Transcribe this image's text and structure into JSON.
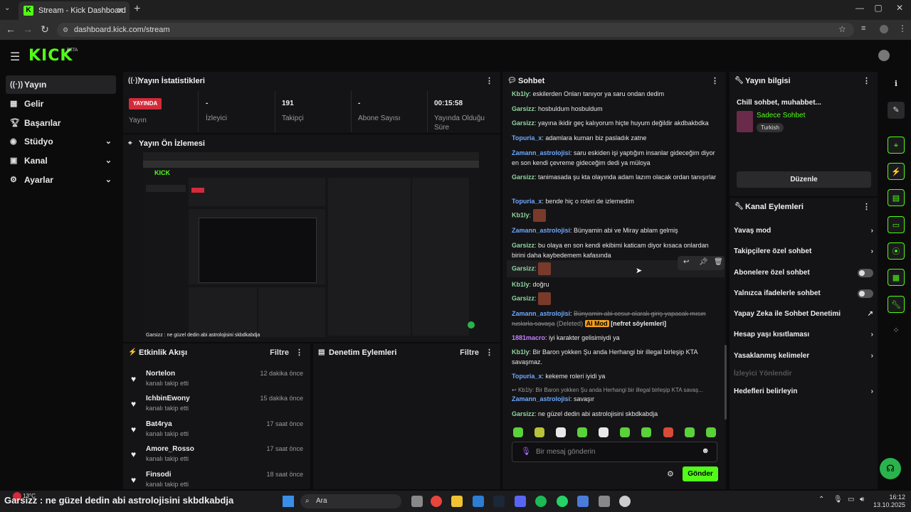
{
  "browser": {
    "tab_title": "Stream - Kick Dashboard",
    "url": "dashboard.kick.com/stream"
  },
  "app": {
    "logo": "KICK",
    "beta": "BETA"
  },
  "sidebar": {
    "items": [
      {
        "label": "Yayın",
        "icon": "broadcast-icon"
      },
      {
        "label": "Gelir",
        "icon": "revenue-icon"
      },
      {
        "label": "Başarılar",
        "icon": "trophy-icon"
      },
      {
        "label": "Stüdyo",
        "icon": "studio-icon"
      },
      {
        "label": "Kanal",
        "icon": "channel-icon"
      },
      {
        "label": "Ayarlar",
        "icon": "gear-icon"
      }
    ]
  },
  "stats": {
    "title": "Yayın İstatistikleri",
    "live_badge": "YAYINDA",
    "live_label": "Yayın",
    "viewers_value": "-",
    "viewers_label": "İzleyici",
    "followers_value": "191",
    "followers_label": "Takipçi",
    "subs_value": "-",
    "subs_label": "Abone Sayısı",
    "uptime_value": "00:15:58",
    "uptime_label": "Yayında Olduğu Süre"
  },
  "preview": {
    "title": "Yayın Ön İzlemesi"
  },
  "activity": {
    "title": "Etkinlik Akışı",
    "filter": "Filtre",
    "items": [
      {
        "name": "Nortelon",
        "sub": "kanalı takip etti",
        "time": "12 dakika önce"
      },
      {
        "name": "IchbinEwony",
        "sub": "kanalı takip etti",
        "time": "15 dakika önce"
      },
      {
        "name": "Bat4rya",
        "sub": "kanalı takip etti",
        "time": "17 saat önce"
      },
      {
        "name": "Amore_Rosso",
        "sub": "kanalı takip etti",
        "time": "17 saat önce"
      },
      {
        "name": "Finsodi",
        "sub": "kanalı takip etti",
        "time": "18 saat önce"
      }
    ]
  },
  "moderation": {
    "title": "Denetim Eylemleri",
    "filter": "Filtre"
  },
  "chat": {
    "title": "Sohbet",
    "messages": [
      {
        "user": "Kb1ly",
        "color": "#8fd6a0",
        "text": "eskilerden Onları tanıyor ya saru ondan dedim"
      },
      {
        "user": "Garsizz",
        "color": "#8fd6a0",
        "text": "hosbuldum hosbuldum"
      },
      {
        "user": "Garsizz",
        "color": "#8fd6a0",
        "text": "yayına ikidir geç kalıyorum hiçte huyum değildir akdbakbdka"
      },
      {
        "user": "Topuria_x",
        "color": "#6ea8ff",
        "text": "adamlara kumarı biz pasladık zatne"
      },
      {
        "user": "Zamann_astrolojisi",
        "color": "#6ea8ff",
        "text": "saru eskiden işi yaptığım insanlar gideceğim diyor en son kendi çevreme gideceğim dedi ya müloya"
      },
      {
        "user": "Garsizz",
        "color": "#8fd6a0",
        "text": "tanimasada şu kta olayında adam lazım olacak ordan tanışırlar"
      },
      {
        "user": "Topuria_x",
        "color": "#6ea8ff",
        "text": "bende hiç o roleri de izlemedim"
      },
      {
        "user": "Kb1ly",
        "color": "#8fd6a0",
        "text": ""
      },
      {
        "user": "Zamann_astrolojisi",
        "color": "#6ea8ff",
        "text": "Bünyamin abi ve Miray ablam gelmiş"
      },
      {
        "user": "Garsizz",
        "color": "#8fd6a0",
        "text": "bu olaya en son kendi ekibimi katicam diyor kısaca onlardan birini daha kaybedemem kafasında"
      },
      {
        "user": "Garsizz",
        "color": "#8fd6a0",
        "text": ""
      },
      {
        "user": "Kb1ly",
        "color": "#8fd6a0",
        "text": "doğru"
      },
      {
        "user": "Garsizz",
        "color": "#8fd6a0",
        "text": ""
      },
      {
        "user": "Zamann_astrolojisi",
        "color": "#6ea8ff",
        "text": "Bünyamin abi cesur olarak giriş yapacak mısın ruslarla savaşa"
      },
      {
        "user": "1881macro",
        "color": "#c77dff",
        "text": "iyi karakter gelisimiydi ya"
      },
      {
        "user": "Kb1ly",
        "color": "#8fd6a0",
        "text": "Bir Baron yokken Şu anda Herhangi bir illegal birleşip KTA savaşmaz."
      },
      {
        "user": "Topuria_x",
        "color": "#6ea8ff",
        "text": "kekeme roleri iyidi ya"
      },
      {
        "user": "Zamann_astrolojisi",
        "color": "#6ea8ff",
        "text": "savaşır"
      },
      {
        "user": "Garsizz",
        "color": "#8fd6a0",
        "text": "ne güzel dedin abi astrolojisini skbdkabdja"
      }
    ],
    "deleted_tag": "(Deleted)",
    "ai_mod": "AI Mod",
    "hate_tag": "[nefret söylemleri]",
    "reply_preview": "Kb1ly: Bir Baron yokken Şu anda Herhangi bir illegal birleşip KTA savaş...",
    "input_placeholder": "Bir mesaj gönderin",
    "send_label": "Gönder"
  },
  "stream_info": {
    "title": "Yayın bilgisi",
    "stream_title": "Chill sohbet, muhabbet...",
    "category": "Sadece Sohbet",
    "language": "Turkish",
    "edit_label": "Düzenle"
  },
  "channel_actions": {
    "title": "Kanal Eylemleri",
    "items": [
      {
        "label": "Yavaş mod",
        "type": "arrow"
      },
      {
        "label": "Takipçilere özel sohbet",
        "type": "arrow"
      },
      {
        "label": "Abonelere özel sohbet",
        "type": "toggle"
      },
      {
        "label": "Yalnızca ifadelerle sohbet",
        "type": "toggle"
      },
      {
        "label": "Yapay Zeka ile Sohbet Denetimi",
        "type": "external"
      },
      {
        "label": "Hesap yaşı kısıtlaması",
        "type": "arrow"
      },
      {
        "label": "Yasaklanmış kelimeler",
        "type": "arrow"
      },
      {
        "label": "İzleyici Yönlendir",
        "type": "disabled"
      },
      {
        "label": "Hedefleri belirleyin",
        "type": "arrow"
      }
    ]
  },
  "taskbar": {
    "chat_overlay": "Garsizz : ne güzel dedin abi astrolojisini skbdkabdja",
    "weather": "13°C",
    "search": "Ara",
    "time": "16:12",
    "date": "13.10.2025"
  },
  "colors": {
    "accent": "#53fc18",
    "live": "#d42a3a"
  }
}
